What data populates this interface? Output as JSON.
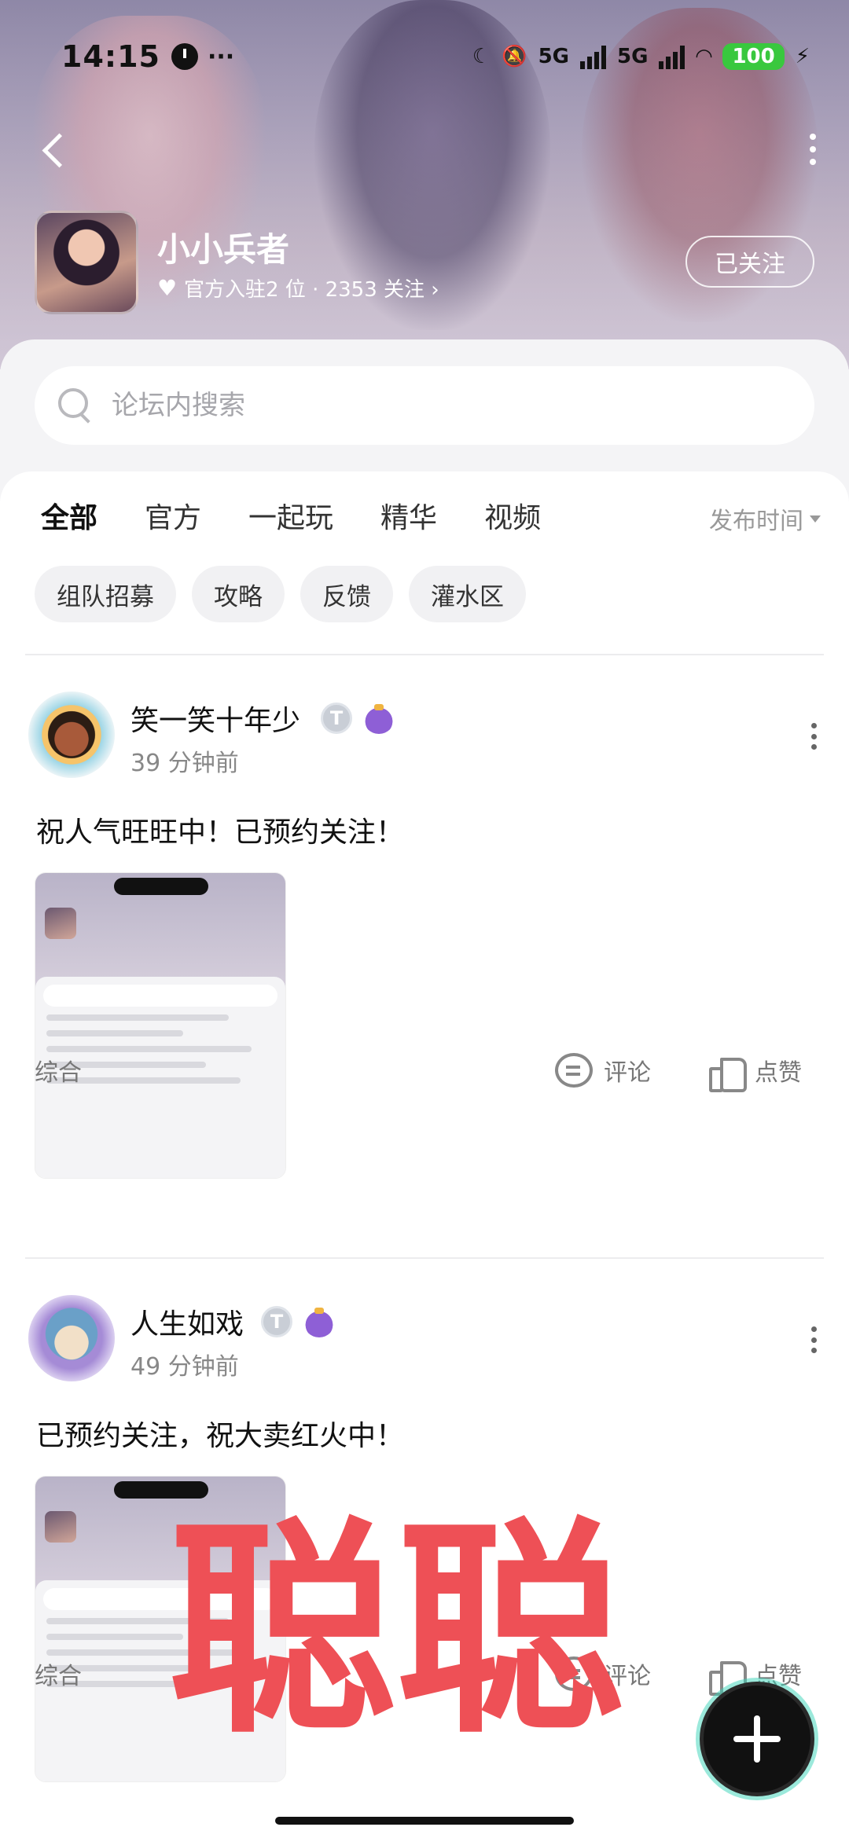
{
  "status_bar": {
    "time": "14:15",
    "dots": "···",
    "network1": "5G",
    "network2": "5G",
    "battery": "100"
  },
  "forum": {
    "name": "小小兵者",
    "meta": "官方入驻2 位 · 2353 关注 ›",
    "follow_label": "已关注"
  },
  "search": {
    "placeholder": "论坛内搜索"
  },
  "tabs": [
    {
      "label": "全部",
      "active": true
    },
    {
      "label": "官方"
    },
    {
      "label": "一起玩"
    },
    {
      "label": "精华"
    },
    {
      "label": "视频"
    }
  ],
  "sort": {
    "label": "发布时间"
  },
  "chips": [
    "组队招募",
    "攻略",
    "反馈",
    "灌水区"
  ],
  "posts": [
    {
      "author": "笑一笑十年少",
      "time": "39 分钟前",
      "text": "祝人气旺旺中！已预约关注！",
      "category": "综合",
      "comment_label": "评论",
      "like_label": "点赞"
    },
    {
      "author": "人生如戏",
      "time": "49 分钟前",
      "text": "已预约关注，祝大卖红火中！",
      "category": "综合",
      "comment_label": "评论",
      "like_label": "点赞"
    }
  ],
  "watermark": "聪聪",
  "colors": {
    "accent": "#38d3b8",
    "watermark": "#ee5056"
  }
}
